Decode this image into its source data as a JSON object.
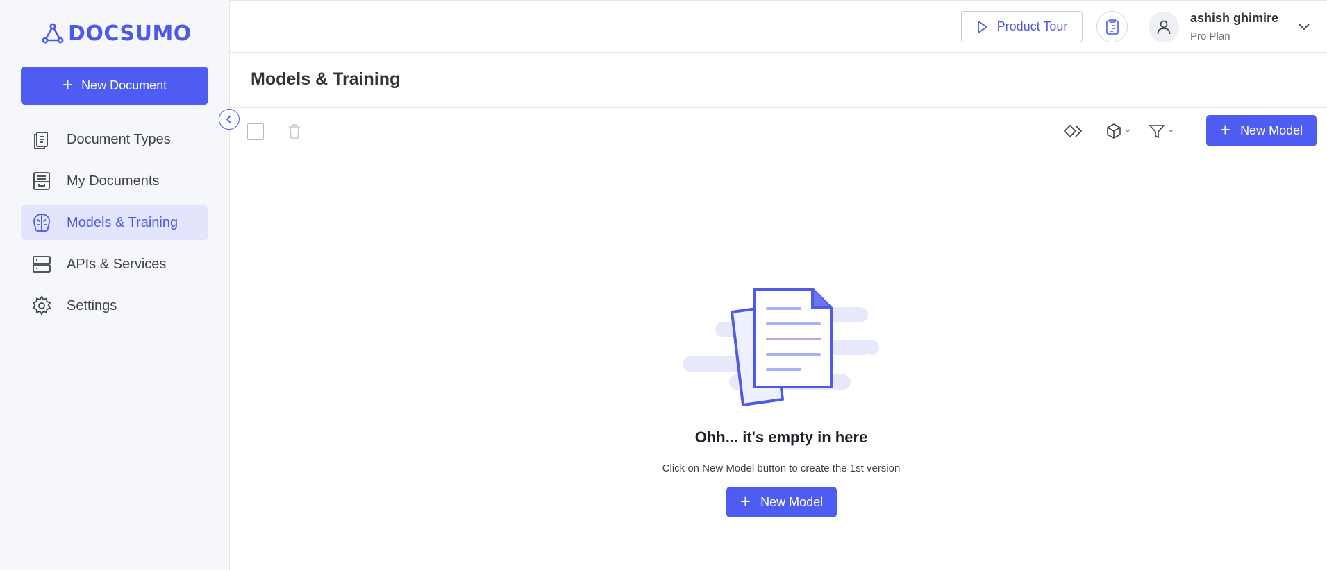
{
  "brand": {
    "name": "DOCSUMO",
    "color": "#4f5ae6",
    "icon": "docsumo-logo-icon"
  },
  "sidebar": {
    "new_document_label": "New Document",
    "items": [
      {
        "label": "Document Types",
        "icon": "document-types-icon",
        "active": false
      },
      {
        "label": "My Documents",
        "icon": "archive-icon",
        "active": false
      },
      {
        "label": "Models & Training",
        "icon": "brain-icon",
        "active": true
      },
      {
        "label": "APIs & Services",
        "icon": "server-icon",
        "active": false
      },
      {
        "label": "Settings",
        "icon": "gear-icon",
        "active": false
      }
    ]
  },
  "header": {
    "product_tour_label": "Product Tour",
    "user": {
      "name": "ashish ghimire",
      "plan": "Pro Plan"
    }
  },
  "page": {
    "title": "Models & Training"
  },
  "toolbar": {
    "new_model_label": "New Model"
  },
  "empty_state": {
    "title": "Ohh... it's empty in here",
    "subtitle": "Click on New Model button to create the 1st version",
    "button_label": "New Model"
  },
  "colors": {
    "accent": "#4f5cf2",
    "active_bg": "#e2e5fb",
    "sidebar_bg": "#f6f7fb"
  }
}
